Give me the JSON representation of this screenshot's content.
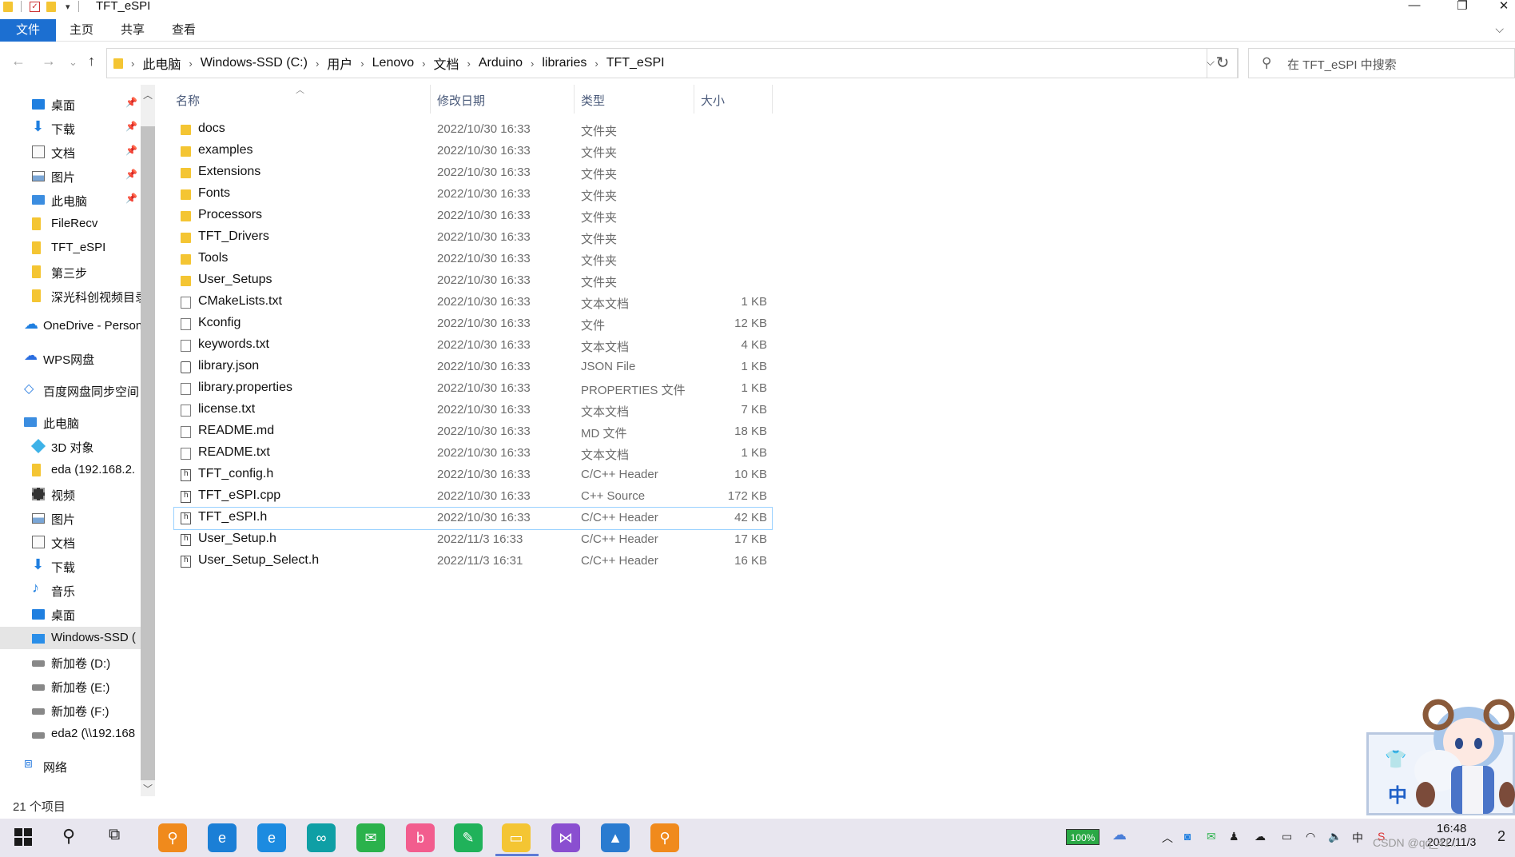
{
  "window": {
    "title": "TFT_eSPI",
    "controls": {
      "minimize": "—",
      "maximize": "❐",
      "close": "✕"
    }
  },
  "ribbon": {
    "tabs": [
      "文件",
      "主页",
      "共享",
      "查看"
    ],
    "expand": "⌵"
  },
  "address": {
    "crumbs": [
      "此电脑",
      "Windows-SSD (C:)",
      "用户",
      "Lenovo",
      "文档",
      "Arduino",
      "libraries",
      "TFT_eSPI"
    ],
    "separator": "›",
    "dropdown": "⌵",
    "refresh": "↻"
  },
  "search": {
    "placeholder": "在 TFT_eSPI 中搜索",
    "icon": "search-icon"
  },
  "nav_buttons": {
    "back": "←",
    "forward": "→",
    "recent": "⌄",
    "up": "↑"
  },
  "sidebar": {
    "items": [
      {
        "label": "桌面",
        "icon": "desktop-icon",
        "pinned": true
      },
      {
        "label": "下载",
        "icon": "download-icon",
        "pinned": true
      },
      {
        "label": "文档",
        "icon": "document-icon",
        "pinned": true
      },
      {
        "label": "图片",
        "icon": "picture-icon",
        "pinned": true
      },
      {
        "label": "此电脑",
        "icon": "computer-icon",
        "pinned": true
      },
      {
        "label": "FileRecv",
        "icon": "folder-icon",
        "pinned": false
      },
      {
        "label": "TFT_eSPI",
        "icon": "folder-icon",
        "pinned": false
      },
      {
        "label": "第三步",
        "icon": "folder-icon",
        "pinned": false
      },
      {
        "label": "深光科创视频目录",
        "icon": "folder-icon",
        "pinned": false
      },
      {
        "label": "OneDrive - Personal",
        "icon": "onedrive-icon",
        "pinned": false
      },
      {
        "label": "WPS网盘",
        "icon": "wps-cloud-icon",
        "pinned": false
      },
      {
        "label": "百度网盘同步空间",
        "icon": "baidu-sync-icon",
        "pinned": false
      },
      {
        "label": "此电脑",
        "icon": "computer-icon",
        "pinned": false
      },
      {
        "label": "3D 对象",
        "icon": "3d-objects-icon",
        "pinned": false
      },
      {
        "label": "eda (192.168.2.",
        "icon": "network-folder-icon",
        "pinned": false
      },
      {
        "label": "视频",
        "icon": "video-icon",
        "pinned": false
      },
      {
        "label": "图片",
        "icon": "picture-icon",
        "pinned": false
      },
      {
        "label": "文档",
        "icon": "document-icon",
        "pinned": false
      },
      {
        "label": "下载",
        "icon": "download-icon",
        "pinned": false
      },
      {
        "label": "音乐",
        "icon": "music-icon",
        "pinned": false
      },
      {
        "label": "桌面",
        "icon": "desktop-icon",
        "pinned": false
      },
      {
        "label": "Windows-SSD (",
        "icon": "windows-drive-icon",
        "pinned": false,
        "selected": true
      },
      {
        "label": "新加卷 (D:)",
        "icon": "drive-icon",
        "pinned": false
      },
      {
        "label": "新加卷 (E:)",
        "icon": "drive-icon",
        "pinned": false
      },
      {
        "label": "新加卷 (F:)",
        "icon": "drive-icon",
        "pinned": false
      },
      {
        "label": "eda2 (\\\\192.168",
        "icon": "network-drive-icon",
        "pinned": false
      },
      {
        "label": "网络",
        "icon": "network-icon",
        "pinned": false
      }
    ],
    "pin_glyph": "📌"
  },
  "columns": {
    "name": "名称",
    "date": "修改日期",
    "type": "类型",
    "size": "大小"
  },
  "files": [
    {
      "name": "docs",
      "date": "2022/10/30 16:33",
      "type": "文件夹",
      "size": "",
      "kind": "folder"
    },
    {
      "name": "examples",
      "date": "2022/10/30 16:33",
      "type": "文件夹",
      "size": "",
      "kind": "folder"
    },
    {
      "name": "Extensions",
      "date": "2022/10/30 16:33",
      "type": "文件夹",
      "size": "",
      "kind": "folder"
    },
    {
      "name": "Fonts",
      "date": "2022/10/30 16:33",
      "type": "文件夹",
      "size": "",
      "kind": "folder"
    },
    {
      "name": "Processors",
      "date": "2022/10/30 16:33",
      "type": "文件夹",
      "size": "",
      "kind": "folder"
    },
    {
      "name": "TFT_Drivers",
      "date": "2022/10/30 16:33",
      "type": "文件夹",
      "size": "",
      "kind": "folder"
    },
    {
      "name": "Tools",
      "date": "2022/10/30 16:33",
      "type": "文件夹",
      "size": "",
      "kind": "folder"
    },
    {
      "name": "User_Setups",
      "date": "2022/10/30 16:33",
      "type": "文件夹",
      "size": "",
      "kind": "folder"
    },
    {
      "name": "CMakeLists.txt",
      "date": "2022/10/30 16:33",
      "type": "文本文档",
      "size": "1 KB",
      "kind": "file"
    },
    {
      "name": "Kconfig",
      "date": "2022/10/30 16:33",
      "type": "文件",
      "size": "12 KB",
      "kind": "file"
    },
    {
      "name": "keywords.txt",
      "date": "2022/10/30 16:33",
      "type": "文本文档",
      "size": "4 KB",
      "kind": "file"
    },
    {
      "name": "library.json",
      "date": "2022/10/30 16:33",
      "type": "JSON File",
      "size": "1 KB",
      "kind": "json"
    },
    {
      "name": "library.properties",
      "date": "2022/10/30 16:33",
      "type": "PROPERTIES 文件",
      "size": "1 KB",
      "kind": "file"
    },
    {
      "name": "license.txt",
      "date": "2022/10/30 16:33",
      "type": "文本文档",
      "size": "7 KB",
      "kind": "file"
    },
    {
      "name": "README.md",
      "date": "2022/10/30 16:33",
      "type": "MD 文件",
      "size": "18 KB",
      "kind": "file"
    },
    {
      "name": "README.txt",
      "date": "2022/10/30 16:33",
      "type": "文本文档",
      "size": "1 KB",
      "kind": "file"
    },
    {
      "name": "TFT_config.h",
      "date": "2022/10/30 16:33",
      "type": "C/C++ Header",
      "size": "10 KB",
      "kind": "header"
    },
    {
      "name": "TFT_eSPI.cpp",
      "date": "2022/10/30 16:33",
      "type": "C++ Source",
      "size": "172 KB",
      "kind": "header"
    },
    {
      "name": "TFT_eSPI.h",
      "date": "2022/10/30 16:33",
      "type": "C/C++ Header",
      "size": "42 KB",
      "kind": "header",
      "selected": true
    },
    {
      "name": "User_Setup.h",
      "date": "2022/11/3 16:33",
      "type": "C/C++ Header",
      "size": "17 KB",
      "kind": "header"
    },
    {
      "name": "User_Setup_Select.h",
      "date": "2022/11/3 16:31",
      "type": "C/C++ Header",
      "size": "16 KB",
      "kind": "header"
    }
  ],
  "status": {
    "item_count": "21 个项目"
  },
  "ime": {
    "label": "中",
    "skin_icon": "shirt-icon"
  },
  "taskbar": {
    "apps": [
      {
        "name": "search-app",
        "glyph": "⚲",
        "color": "#f08a1c"
      },
      {
        "name": "edge",
        "glyph": "e",
        "color": "#1b7fd6"
      },
      {
        "name": "ie",
        "glyph": "e",
        "color": "#1c8be0"
      },
      {
        "name": "arduino",
        "glyph": "∞",
        "color": "#0f9fa5"
      },
      {
        "name": "wechat",
        "glyph": "✉",
        "color": "#2bb24c"
      },
      {
        "name": "bilibili",
        "glyph": "b",
        "color": "#f25d8e"
      },
      {
        "name": "note",
        "glyph": "✎",
        "color": "#20b25a"
      },
      {
        "name": "file-explorer",
        "glyph": "▭",
        "color": "#f4c533"
      },
      {
        "name": "visual-studio",
        "glyph": "⋈",
        "color": "#8a4fd0"
      },
      {
        "name": "photos",
        "glyph": "▲",
        "color": "#2a7bd0"
      },
      {
        "name": "search-tool",
        "glyph": "⚲",
        "color": "#f08a1c"
      }
    ],
    "battery": "100%",
    "time": "16:48",
    "date": "2022/11/3",
    "ime_indicator": "中",
    "notification": "2"
  },
  "watermark": "CSDN @qq_41..."
}
